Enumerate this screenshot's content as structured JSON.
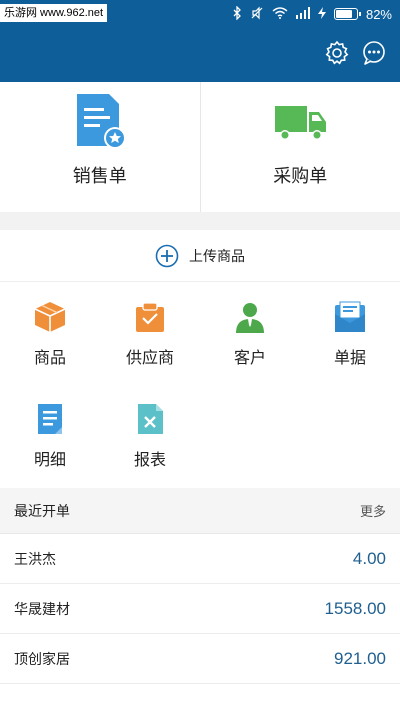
{
  "statusbar": {
    "watermark": "乐游网 www.962.net",
    "battery_text": "82%",
    "battery_level": 0.82
  },
  "header": {
    "settings_icon": "gear-icon",
    "chat_icon": "chat-bubble-icon"
  },
  "topcards": [
    {
      "label": "销售单",
      "icon": "sales-order-icon",
      "color": "#3d99dd"
    },
    {
      "label": "采购单",
      "icon": "purchase-truck-icon",
      "color": "#57b856"
    }
  ],
  "upload": {
    "label": "上传商品"
  },
  "grid": [
    {
      "label": "商品",
      "icon": "product-box-icon",
      "color": "#f08f3a"
    },
    {
      "label": "供应商",
      "icon": "supplier-icon",
      "color": "#f08f3a"
    },
    {
      "label": "客户",
      "icon": "customer-icon",
      "color": "#4ca84a"
    },
    {
      "label": "单据",
      "icon": "documents-icon",
      "color": "#3d99dd"
    },
    {
      "label": "明细",
      "icon": "details-icon",
      "color": "#3d99dd"
    },
    {
      "label": "报表",
      "icon": "report-icon",
      "color": "#5bc0c8"
    }
  ],
  "recent": {
    "title": "最近开单",
    "more": "更多",
    "items": [
      {
        "name": "王洪杰",
        "amount": "4.00"
      },
      {
        "name": "华晟建材",
        "amount": "1558.00"
      },
      {
        "name": "顶创家居",
        "amount": "921.00"
      },
      {
        "name": "",
        "amount": ""
      }
    ]
  }
}
